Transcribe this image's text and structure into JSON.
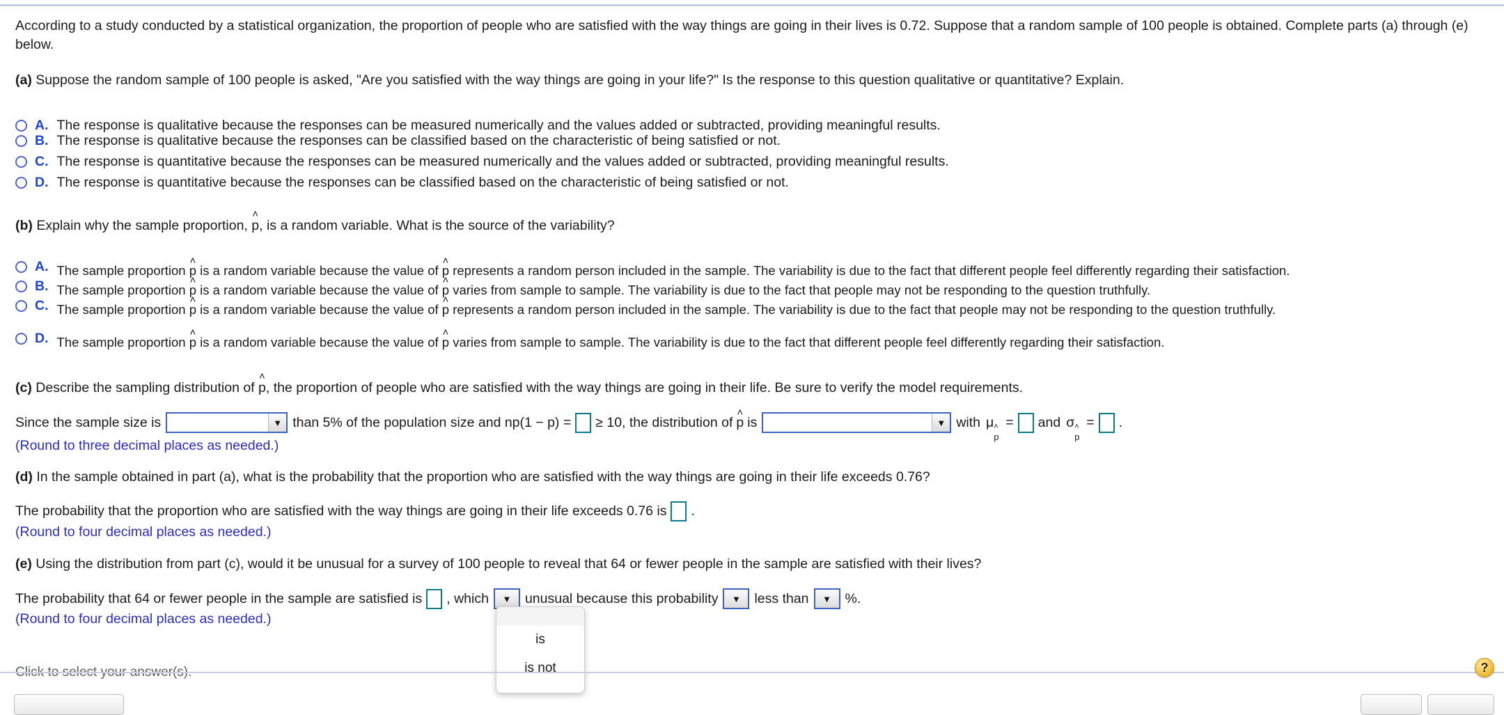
{
  "intro": {
    "text": "According to a study conducted by a statistical organization, the proportion of people who are satisfied with the way things are going in their lives is 0.72. Suppose that a random sample of 100 people is obtained. Complete parts (a) through (e) below."
  },
  "parts": {
    "a": {
      "label": "(a)",
      "question": "Suppose the random sample of 100 people is asked, \"Are you satisfied with the way things are going in your life?\" Is the response to this question qualitative or quantitative? Explain.",
      "choices": [
        {
          "letter": "A.",
          "text": "The response is qualitative because the responses can be measured numerically and the values added or subtracted, providing meaningful results."
        },
        {
          "letter": "B.",
          "text": "The response is qualitative because the responses can be classified based on the characteristic of being satisfied or not."
        },
        {
          "letter": "C.",
          "text": "The response is quantitative because the responses can be measured numerically and the values added or subtracted, providing meaningful results."
        },
        {
          "letter": "D.",
          "text": "The response is quantitative because the responses can be classified based on the characteristic of being satisfied or not."
        }
      ]
    },
    "b": {
      "label": "(b)",
      "q_pre": "Explain why the sample proportion, ",
      "q_post": ", is a random variable. What is the source of the variability?",
      "choices": [
        {
          "letter": "A.",
          "seg1": "The sample proportion ",
          "seg2": " is a random variable because the value of ",
          "seg3": " represents a random person included in the sample. The variability is due to the fact that different people feel differently regarding their satisfaction."
        },
        {
          "letter": "B.",
          "seg1": "The sample proportion ",
          "seg2": " is a random variable because the value of ",
          "seg3": " varies from sample to sample. The variability is due to the fact that people may not be responding to the question truthfully."
        },
        {
          "letter": "C.",
          "seg1": "The sample proportion ",
          "seg2": " is a random variable because the value of ",
          "seg3": " represents a random person included in the sample. The variability is due to the fact that people may not be responding to the question truthfully."
        },
        {
          "letter": "D.",
          "seg1": "The sample proportion ",
          "seg2": " is a random variable because the value of ",
          "seg3": " varies from sample to sample. The variability is due to the fact that different people feel differently regarding their satisfaction."
        }
      ]
    },
    "c": {
      "label": "(c)",
      "q_pre": "Describe the sampling distribution of ",
      "q_post": ", the proportion of people who are satisfied with the way things are going in their life. Be sure to verify the model requirements.",
      "s1": "Since the sample size is",
      "s2": "than 5% of the population size and np(1 − p) =",
      "s3": "≥ 10, the distribution of",
      "s4": "is",
      "s5": "with",
      "s6": "=",
      "s7": "and",
      "s8": "=",
      "s9": ".",
      "dropdown1_value": "",
      "dropdown2_value": "",
      "input1_value": "",
      "mu_value": "",
      "sigma_value": "",
      "round_note": "(Round to three decimal places as needed.)"
    },
    "d": {
      "label": "(d)",
      "question": "In the sample obtained in part (a), what is the probability that the proportion who are satisfied with the way things are going in their life exceeds 0.76?",
      "answer_pre": "The probability that the proportion who are satisfied with the way things are going in their life exceeds 0.76 is",
      "answer_post": ".",
      "input_value": "",
      "round_note": "(Round to four decimal places as needed.)"
    },
    "e": {
      "label": "(e)",
      "question": "Using the distribution from part (c), would it be unusual for a survey of 100 people to reveal that 64 or fewer people in the sample are satisfied with their lives?",
      "s1": "The probability that 64 or fewer people in the sample are satisfied is",
      "s2": ", which",
      "s3": "unusual because this probability",
      "s4": "less than",
      "s5": "%.",
      "input_value": "",
      "dropdown1_value": "",
      "dropdown2_value": "",
      "dropdown3_value": "",
      "round_note": "(Round to four decimal places as needed.)"
    }
  },
  "dropdown_popup": {
    "open": true,
    "options": [
      "is",
      "is not"
    ]
  },
  "footer": {
    "status": "Click to select your answer(s).",
    "help_icon": "question-mark-icon",
    "help_label": "?"
  },
  "symbols": {
    "hat": "˄",
    "p": "p",
    "mu": "μ",
    "sigma": "σ",
    "arrow_down": "▼"
  },
  "colors": {
    "radio_blue": "#4f63d2",
    "letter_blue": "#1f46c8",
    "dropdown_border": "#3b63c4",
    "textbox_border": "#0a7c8c",
    "hint_blue": "#2b2bc6",
    "rule": "#c7cede",
    "help_gold": "#f0bc3d"
  }
}
